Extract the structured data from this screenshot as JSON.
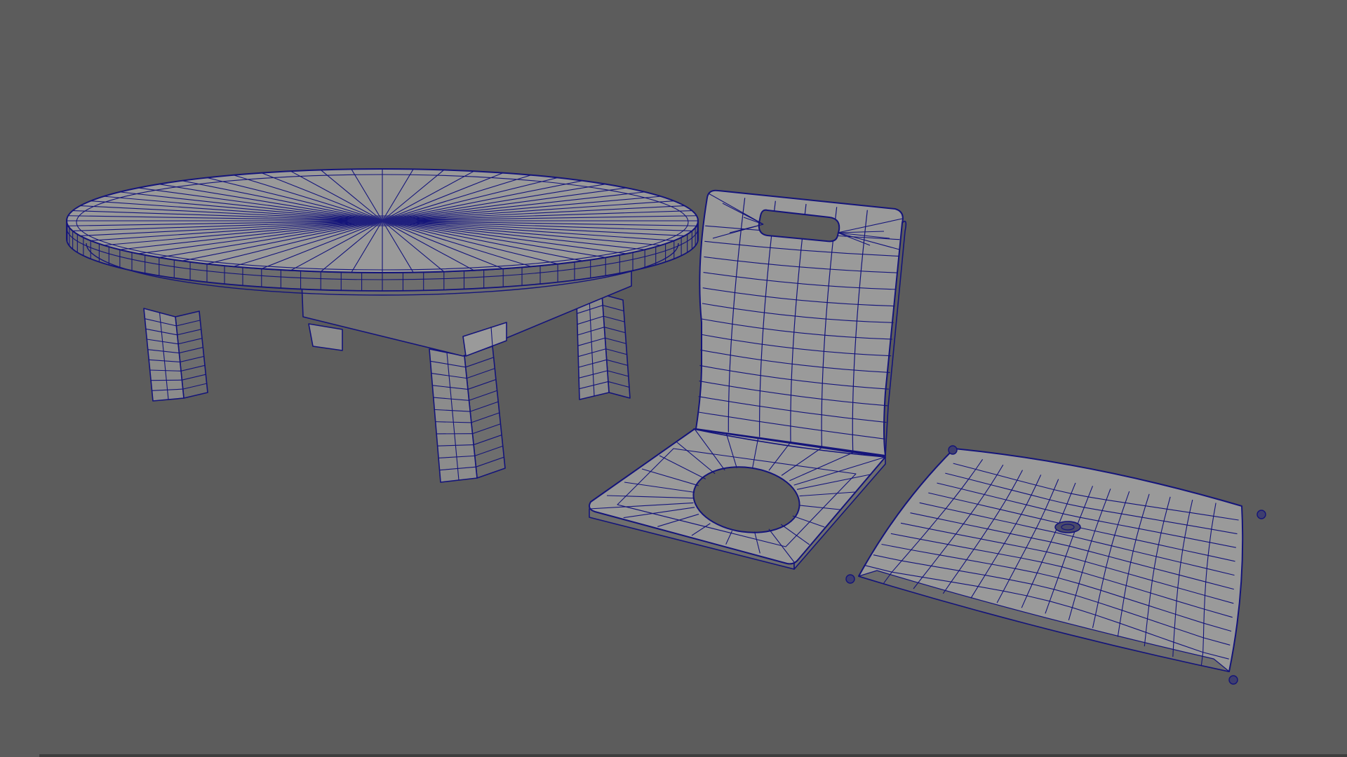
{
  "viewport": {
    "background": "#5c5c5c",
    "mesh_fill": "#8c8c8c",
    "mesh_fill_light": "#9a9a9a",
    "mesh_fill_dark": "#6e6e6e",
    "wireframe_color": "#14147a",
    "display_mode": "wireframe-on-shaded"
  },
  "objects": [
    {
      "name": "low-round-table",
      "type": "polygon-mesh"
    },
    {
      "name": "floor-chair",
      "type": "polygon-mesh"
    },
    {
      "name": "floor-cushion",
      "type": "polygon-mesh"
    }
  ]
}
